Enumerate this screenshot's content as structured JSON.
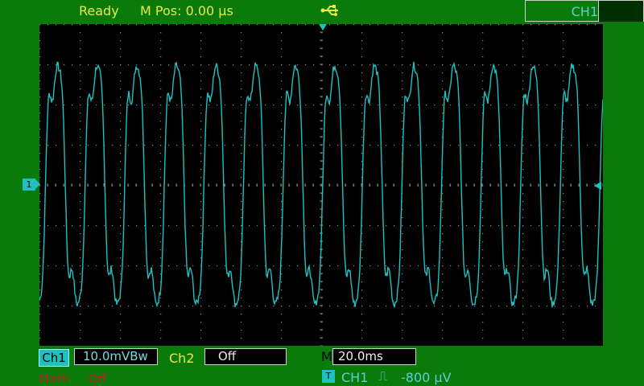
{
  "header": {
    "status": "Ready",
    "mpos": "M Pos: 0.00 µs",
    "menu_title": "CH1"
  },
  "icons": {
    "usb": "usb-icon",
    "ch1_marker": "ch1-ground-marker-icon",
    "trigger_pos": "trigger-position-icon",
    "trigger_level": "trigger-level-icon"
  },
  "footer": {
    "ch1_label": "Ch1",
    "ch1_scale": "10.0mVBw",
    "ch2_label": "Ch2",
    "ch2_value": "Off",
    "time_prefix": "M",
    "timebase": "20.0ms",
    "math_label": "Math",
    "math_value": "Off",
    "trig_icon_label": "T",
    "ch1_marker_label": "1",
    "trig_source": "CH1",
    "trig_edge": "⎍",
    "trig_level": "-800 µV"
  },
  "colors": {
    "background": "#0a7a0a",
    "screen": "#000000",
    "trace": "#1fc0c0",
    "label_yellow": "#e8e84a",
    "math_red": "#c02020"
  }
}
